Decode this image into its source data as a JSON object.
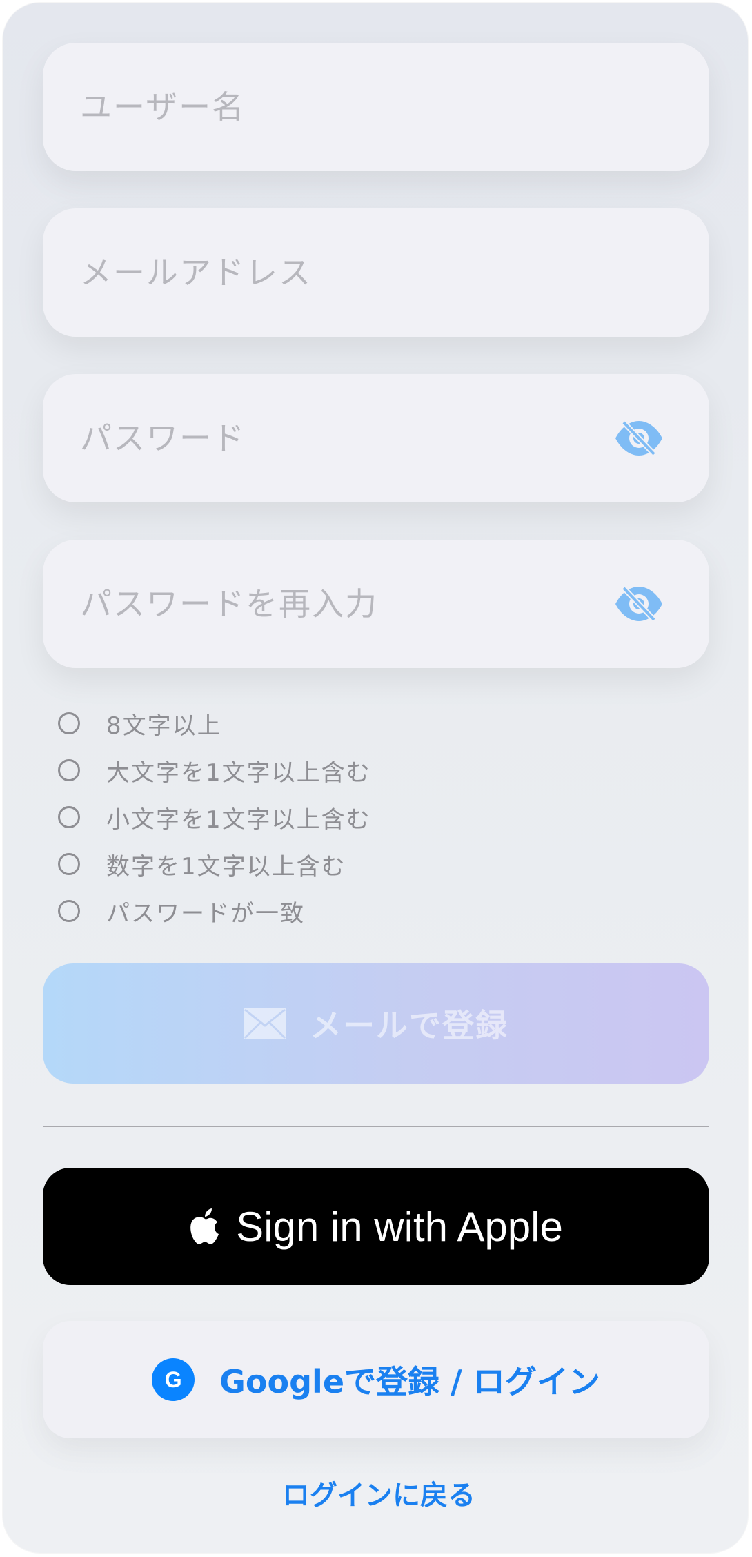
{
  "form": {
    "username": {
      "placeholder": "ユーザー名",
      "value": ""
    },
    "email": {
      "placeholder": "メールアドレス",
      "value": ""
    },
    "password": {
      "placeholder": "パスワード",
      "value": "",
      "toggle_icon": "eye-slash-icon"
    },
    "password_confirm": {
      "placeholder": "パスワードを再入力",
      "value": "",
      "toggle_icon": "eye-slash-icon"
    }
  },
  "requirements": [
    {
      "label": "8文字以上",
      "met": false
    },
    {
      "label": "大文字を1文字以上含む",
      "met": false
    },
    {
      "label": "小文字を1文字以上含む",
      "met": false
    },
    {
      "label": "数字を1文字以上含む",
      "met": false
    },
    {
      "label": "パスワードが一致",
      "met": false
    }
  ],
  "buttons": {
    "email_register": {
      "label": "メールで登録",
      "icon": "envelope-icon",
      "enabled": false
    },
    "apple": {
      "label": "Sign in with Apple",
      "icon": "apple-logo-icon"
    },
    "google": {
      "label": "Googleで登録 / ログイン",
      "icon_letter": "G"
    },
    "back_to_login": {
      "label": "ログインに戻る"
    }
  },
  "colors": {
    "accent": "#1a80f0",
    "placeholder": "#b7b7bd",
    "eye_icon": "#7fbcf5",
    "requirement": "#8e8e93",
    "gradient_start": "#b4d8f9",
    "gradient_end": "#cbc6f2",
    "apple_button": "#000000"
  }
}
